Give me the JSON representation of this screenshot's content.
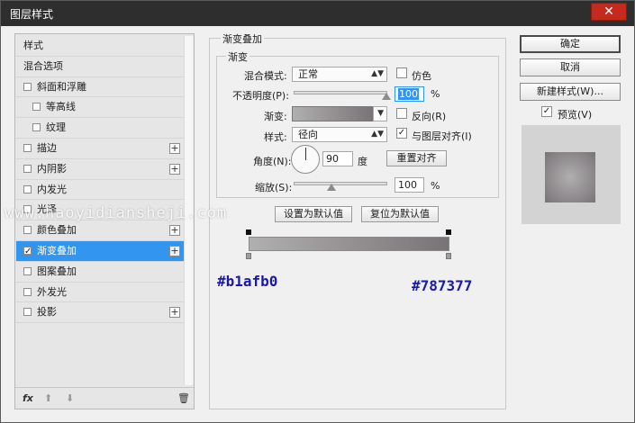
{
  "window": {
    "title": "图层样式",
    "close_glyph": "✕"
  },
  "left_list": [
    {
      "label": "样式",
      "checkbox": false,
      "plus": false,
      "indent": false,
      "checked": false,
      "active": false
    },
    {
      "label": "混合选项",
      "checkbox": false,
      "plus": false,
      "indent": false,
      "checked": false,
      "active": false
    },
    {
      "label": "斜面和浮雕",
      "checkbox": true,
      "plus": false,
      "indent": false,
      "checked": false,
      "active": false
    },
    {
      "label": "等高线",
      "checkbox": true,
      "plus": false,
      "indent": true,
      "checked": false,
      "active": false
    },
    {
      "label": "纹理",
      "checkbox": true,
      "plus": false,
      "indent": true,
      "checked": false,
      "active": false
    },
    {
      "label": "描边",
      "checkbox": true,
      "plus": true,
      "indent": false,
      "checked": false,
      "active": false
    },
    {
      "label": "内阴影",
      "checkbox": true,
      "plus": true,
      "indent": false,
      "checked": false,
      "active": false
    },
    {
      "label": "内发光",
      "checkbox": true,
      "plus": false,
      "indent": false,
      "checked": false,
      "active": false
    },
    {
      "label": "光泽",
      "checkbox": true,
      "plus": false,
      "indent": false,
      "checked": false,
      "active": false
    },
    {
      "label": "颜色叠加",
      "checkbox": true,
      "plus": true,
      "indent": false,
      "checked": false,
      "active": false
    },
    {
      "label": "渐变叠加",
      "checkbox": true,
      "plus": true,
      "indent": false,
      "checked": true,
      "active": true
    },
    {
      "label": "图案叠加",
      "checkbox": true,
      "plus": false,
      "indent": false,
      "checked": false,
      "active": false
    },
    {
      "label": "外发光",
      "checkbox": true,
      "plus": false,
      "indent": false,
      "checked": false,
      "active": false
    },
    {
      "label": "投影",
      "checkbox": true,
      "plus": true,
      "indent": false,
      "checked": false,
      "active": false
    }
  ],
  "left_tools": {
    "fx": "fx",
    "up": "⬆",
    "down": "⬇",
    "trash": "🗑"
  },
  "group_title": "渐变叠加",
  "subgroup_title": "渐变",
  "blend_mode": {
    "label": "混合模式:",
    "value": "正常"
  },
  "dither": {
    "label": "仿色",
    "checked": false
  },
  "opacity": {
    "label": "不透明度(P):",
    "value": "100",
    "unit": "%",
    "slider": 1.0
  },
  "gradient": {
    "label": "渐变:",
    "start_color": "#b1afb0",
    "end_color": "#787377"
  },
  "reverse": {
    "label": "反向(R)",
    "checked": false
  },
  "style": {
    "label": "样式:",
    "value": "径向"
  },
  "align_layer": {
    "label": "与图层对齐(I)",
    "checked": true
  },
  "angle": {
    "label": "角度(N):",
    "value": "90",
    "unit": "度"
  },
  "reset_align": "重置对齐",
  "scale": {
    "label": "缩放(S):",
    "value": "100",
    "unit": "%",
    "slider": 0.4
  },
  "make_default": "设置为默认值",
  "reset_default": "复位为默认值",
  "annotation_left": "#b1afb0",
  "annotation_right": "#787377",
  "watermark": "www.haoyidiansheji.com",
  "buttons": {
    "ok": "确定",
    "cancel": "取消",
    "new_style": "新建样式(W)...",
    "preview": "预览(V)"
  },
  "preview_checked": true,
  "colors": {
    "accent": "#3296f0",
    "annotation": "#1a1aa6",
    "titlebar": "#2e2e2e",
    "close": "#c42b1c"
  }
}
